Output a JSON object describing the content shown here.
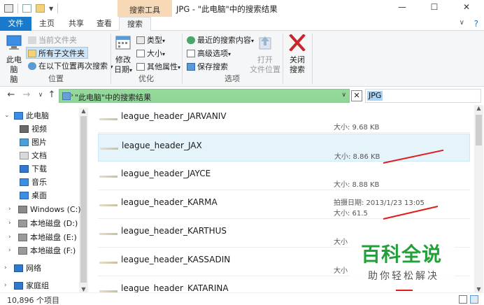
{
  "titlebar": {
    "context_tab": "搜索工具",
    "title": "JPG - \"此电脑\"中的搜索结果",
    "minimize": "—",
    "maximize": "☐",
    "close": "✕"
  },
  "tabs": {
    "file": "文件",
    "home": "主页",
    "share": "共享",
    "view": "查看",
    "search": "搜索",
    "help": "?"
  },
  "ribbon": {
    "location": {
      "this_pc": "此电脑",
      "this_pc2": "脑",
      "current_folder": "当前文件夹",
      "all_subfolders": "所有子文件夹",
      "search_again_in": "在以下位置再次搜索",
      "label": "位置"
    },
    "refine": {
      "modified_date": "修改",
      "modified_date2": "日期",
      "kind": "类型",
      "size": "大小",
      "other_props": "其他属性",
      "label": "优化"
    },
    "options": {
      "recent_searches": "最近的搜索内容",
      "advanced_options": "高级选项",
      "save_search": "保存搜索",
      "open_location": "打开",
      "open_location2": "文件位置",
      "label": "选项"
    },
    "close": {
      "label1": "关闭",
      "label2": "搜索"
    }
  },
  "address": {
    "breadcrumb": "\"此电脑\"中的搜索结果",
    "search_value": "JPG",
    "clear": "✕"
  },
  "nav_pane": [
    {
      "label": "此电脑",
      "icon": "computer-icon"
    },
    {
      "label": "视频",
      "icon": "video-folder-icon"
    },
    {
      "label": "图片",
      "icon": "pictures-folder-icon"
    },
    {
      "label": "文档",
      "icon": "documents-folder-icon"
    },
    {
      "label": "下载",
      "icon": "downloads-folder-icon"
    },
    {
      "label": "音乐",
      "icon": "music-folder-icon"
    },
    {
      "label": "桌面",
      "icon": "desktop-folder-icon"
    },
    {
      "label": "Windows (C:)",
      "icon": "windows-drive-icon"
    },
    {
      "label": "本地磁盘 (D:)",
      "icon": "drive-icon"
    },
    {
      "label": "本地磁盘 (E:)",
      "icon": "drive-icon"
    },
    {
      "label": "本地磁盘 (F:)",
      "icon": "drive-icon"
    },
    {
      "label": "网络",
      "icon": "network-icon"
    },
    {
      "label": "家庭组",
      "icon": "homegroup-icon"
    }
  ],
  "files": [
    {
      "name": "league_header_JARVANIV",
      "meta1": "",
      "meta2": "大小: 9.68 KB"
    },
    {
      "name": "league_header_JAX",
      "meta1": "",
      "meta2": "大小: 8.86 KB"
    },
    {
      "name": "league_header_JAYCE",
      "meta1": "",
      "meta2": "大小: 8.88 KB"
    },
    {
      "name": "league_header_KARMA",
      "meta1": "拍摄日期: 2013/1/23 13:05",
      "meta2": "大小: 61.5"
    },
    {
      "name": "league_header_KARTHUS",
      "meta1": "",
      "meta2": "大小"
    },
    {
      "name": "league_header_KASSADIN",
      "meta1": "",
      "meta2": "大小"
    },
    {
      "name": "league_header_KATARINA",
      "meta1": "",
      "meta2": ""
    }
  ],
  "status": {
    "count": "10,896 个项目"
  },
  "watermark": {
    "title": "百科全说",
    "subtitle": "助你轻松解决"
  },
  "colors": {
    "accent": "#1979ca",
    "address_bar": "#8fd596",
    "context_tab": "#f7d9b7",
    "selection": "#e5f3fb",
    "arrow": "#e21b1b",
    "watermark": "#22a03a"
  }
}
